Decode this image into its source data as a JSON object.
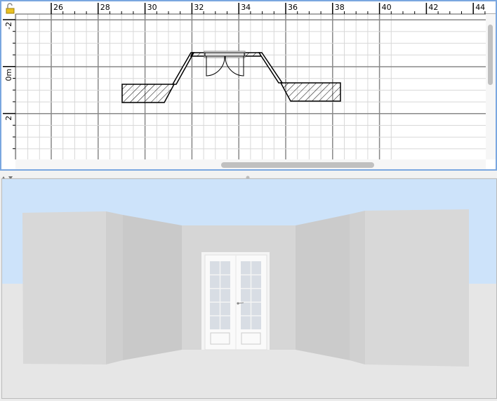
{
  "plan": {
    "x_ruler_labels": [
      "26",
      "28",
      "30",
      "32",
      "34",
      "36",
      "38",
      "40",
      "42",
      "44"
    ],
    "y_ruler_labels": [
      "-2",
      "0m",
      "2"
    ],
    "lock_icon": "unlocked-padlock-icon"
  },
  "splitter": {
    "arrows": [
      "up-arrow-icon",
      "down-arrow-icon"
    ]
  },
  "view3d": {
    "sky_color": "#cde3fa",
    "floor_color": "#e6e6e6"
  }
}
